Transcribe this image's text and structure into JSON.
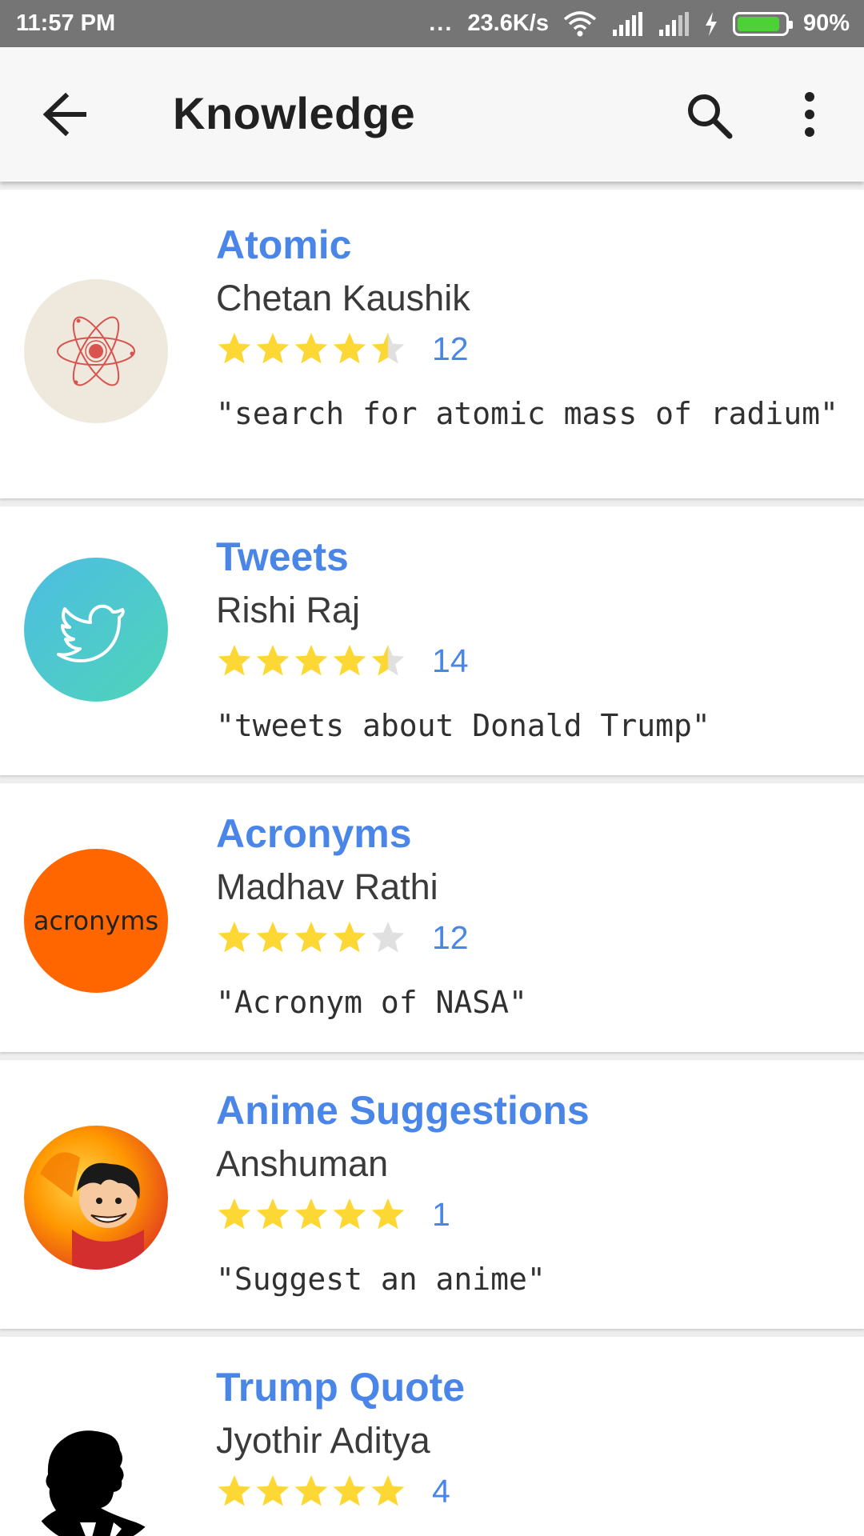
{
  "status_bar": {
    "time": "11:57 PM",
    "dots": "...",
    "net_speed": "23.6K/s",
    "battery": "90%",
    "battery_level": 0.9
  },
  "app_bar": {
    "title": "Knowledge",
    "icons": [
      "arrow-back-icon",
      "search-icon",
      "more-vert-icon"
    ]
  },
  "skills": [
    {
      "name": "Atomic",
      "author": "Chetan Kaushik",
      "rating": 4.5,
      "rating_count": "12",
      "example": "\"search for atomic mass of radium\"",
      "icon": "atom-icon"
    },
    {
      "name": "Tweets",
      "author": "Rishi Raj",
      "rating": 4.5,
      "rating_count": "14",
      "example": "\"tweets about Donald Trump\"",
      "icon": "twitter-bird-icon"
    },
    {
      "name": "Acronyms",
      "author": "Madhav Rathi",
      "rating": 4,
      "rating_count": "12",
      "example": "\"Acronym of NASA\"",
      "icon": "acronyms-logo",
      "icon_text": "acronyms"
    },
    {
      "name": "Anime Suggestions",
      "author": "Anshuman",
      "rating": 5,
      "rating_count": "1",
      "example": "\"Suggest an anime\"",
      "icon": "anime-character-image"
    },
    {
      "name": "Trump Quote",
      "author": "Jyothir Aditya",
      "rating": 5,
      "rating_count": "4",
      "example": "",
      "icon": "trump-silhouette-image"
    }
  ],
  "colors": {
    "status_bar": "#757575",
    "app_bar": "#f7f7f7",
    "skill_name": "#4a86e8",
    "star_filled": "#fdd835",
    "star_empty": "#e0e0e0",
    "acronyms_bg": "#ff6600",
    "atomic_bg": "#efe9dd"
  }
}
